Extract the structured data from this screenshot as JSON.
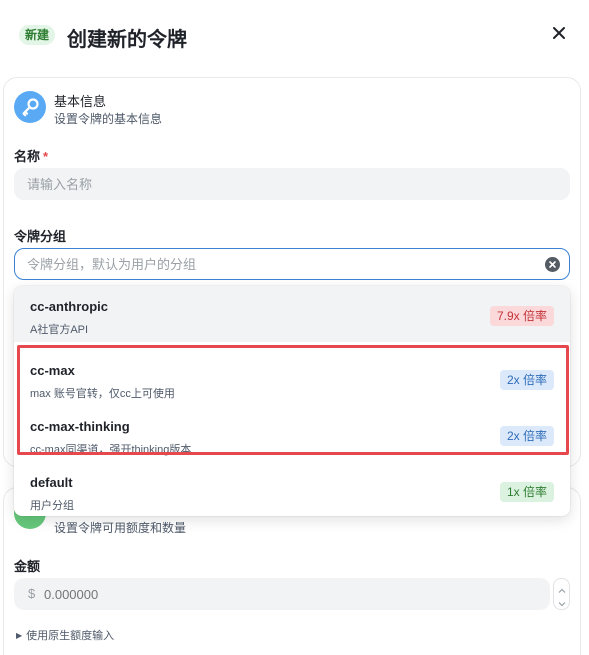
{
  "header": {
    "badge": "新建",
    "title": "创建新的令牌"
  },
  "basic": {
    "title": "基本信息",
    "subtitle": "设置令牌的基本信息",
    "name_label": "名称",
    "required_mark": "*",
    "name_placeholder": "请输入名称",
    "group_label": "令牌分组",
    "group_placeholder": "令牌分组，默认为用户的分组"
  },
  "group_options": [
    {
      "name": "cc-anthropic",
      "desc": "A社官方API",
      "rate": "7.9x 倍率",
      "rate_color": "#c33237"
    },
    {
      "name": "cc-max",
      "desc": "max 账号官转，仅cc上可使用",
      "rate": "2x 倍率",
      "rate_color": "#2f6db8"
    },
    {
      "name": "cc-max-thinking",
      "desc": "cc-max同渠道，强开thinking版本",
      "rate": "2x 倍率",
      "rate_color": "#2f6db8"
    },
    {
      "name": "default",
      "desc": "用户分组",
      "rate": "1x 倍率",
      "rate_color": "#2e7d32"
    }
  ],
  "quota": {
    "subtitle": "设置令牌可用额度和数量",
    "amount_label": "金额",
    "currency": "$",
    "amount_placeholder": "0.000000",
    "raw_toggle": "使用原生额度输入"
  },
  "colors": {
    "accent": "#3b82d6",
    "highlight": "#e5484d",
    "icon_blue": "#5aa9f5",
    "icon_green": "#66c97c"
  },
  "icons": {
    "close": "close-icon",
    "key": "key-icon",
    "clear": "clear-icon",
    "quota": "wallet-icon"
  }
}
